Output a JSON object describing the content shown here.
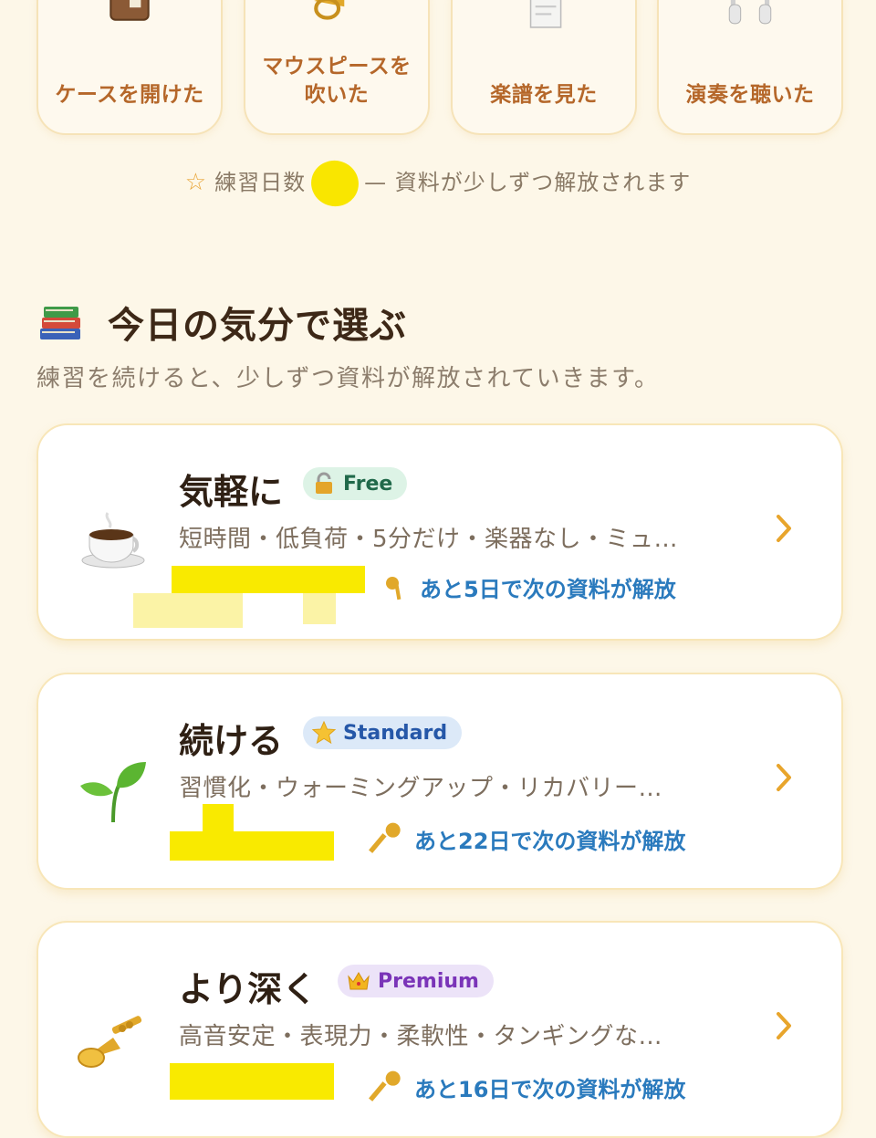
{
  "tiles": [
    {
      "label": "ケースを開けた",
      "icon": "suitcase-icon"
    },
    {
      "label": "マウスピースを吹いた",
      "icon": "trumpet-icon"
    },
    {
      "label": "楽譜を見た",
      "icon": "document-icon"
    },
    {
      "label": "演奏を聴いた",
      "icon": "headphones-icon"
    }
  ],
  "practice": {
    "prefix": "練習日数",
    "suffix": "— 資料が少しずつ解放されます"
  },
  "section": {
    "title": "今日の気分で選ぶ",
    "subtitle": "練習を続けると、少しずつ資料が解放されていきます。"
  },
  "cards": [
    {
      "title": "気軽に",
      "badge": "Free",
      "badge_icon": "lock-icon",
      "desc": "短時間・低負荷・5分だけ・楽器なし・ミュ…",
      "unlock": "あと5日で次の資料が解放",
      "icon": "coffee-icon"
    },
    {
      "title": "続ける",
      "badge": "Standard",
      "badge_icon": "star-icon",
      "desc": "習慣化・ウォーミングアップ・リカバリー…",
      "unlock": "あと22日で次の資料が解放",
      "icon": "seedling-icon"
    },
    {
      "title": "より深く",
      "badge": "Premium",
      "badge_icon": "crown-icon",
      "desc": "高音安定・表現力・柔軟性・タンギングな…",
      "unlock": "あと16日で次の資料が解放",
      "icon": "trumpet-icon"
    }
  ],
  "colors": {
    "background": "#FDF7E8",
    "accent_orange": "#B5672A",
    "link_blue": "#2A7ABD",
    "chevron": "#E8A52C"
  }
}
